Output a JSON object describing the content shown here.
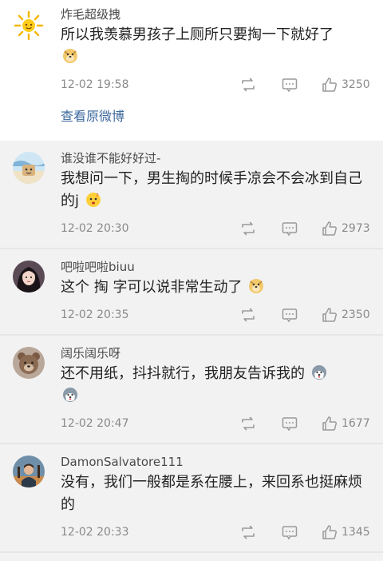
{
  "comments": [
    {
      "username": "炸毛超级拽",
      "text": "所以我羡慕男孩子上厕所只要掏一下就好了",
      "time": "12-02 19:58",
      "likes": "3250",
      "avatar": "sun-avatar",
      "view_original": "查看原微博"
    },
    {
      "username": "谁没谁不能好好过-",
      "text": "我想问一下，男生掏的时候手凉会不会冰到自己的j",
      "time": "12-02 20:30",
      "likes": "2973",
      "avatar": "cartoon-avatar"
    },
    {
      "username": "吧啦吧啦biuu",
      "text": "这个 掏 字可以说非常生动了",
      "time": "12-02 20:35",
      "likes": "2350",
      "avatar": "girl-avatar"
    },
    {
      "username": "阔乐阔乐呀",
      "text": "还不用纸，抖抖就行，我朋友告诉我的",
      "time": "12-02 20:47",
      "likes": "1677",
      "avatar": "bear-avatar"
    },
    {
      "username": "DamonSalvatore111",
      "text": "没有，我们一般都是系在腰上，来回系也挺麻烦的",
      "time": "12-02 20:33",
      "likes": "1345",
      "avatar": "portrait-avatar"
    }
  ],
  "colors": {
    "link": "#3e6a9e",
    "meta_gray": "#8a8a8a",
    "first_bg": "#ffffff",
    "rest_bg": "#f2f2f2"
  }
}
